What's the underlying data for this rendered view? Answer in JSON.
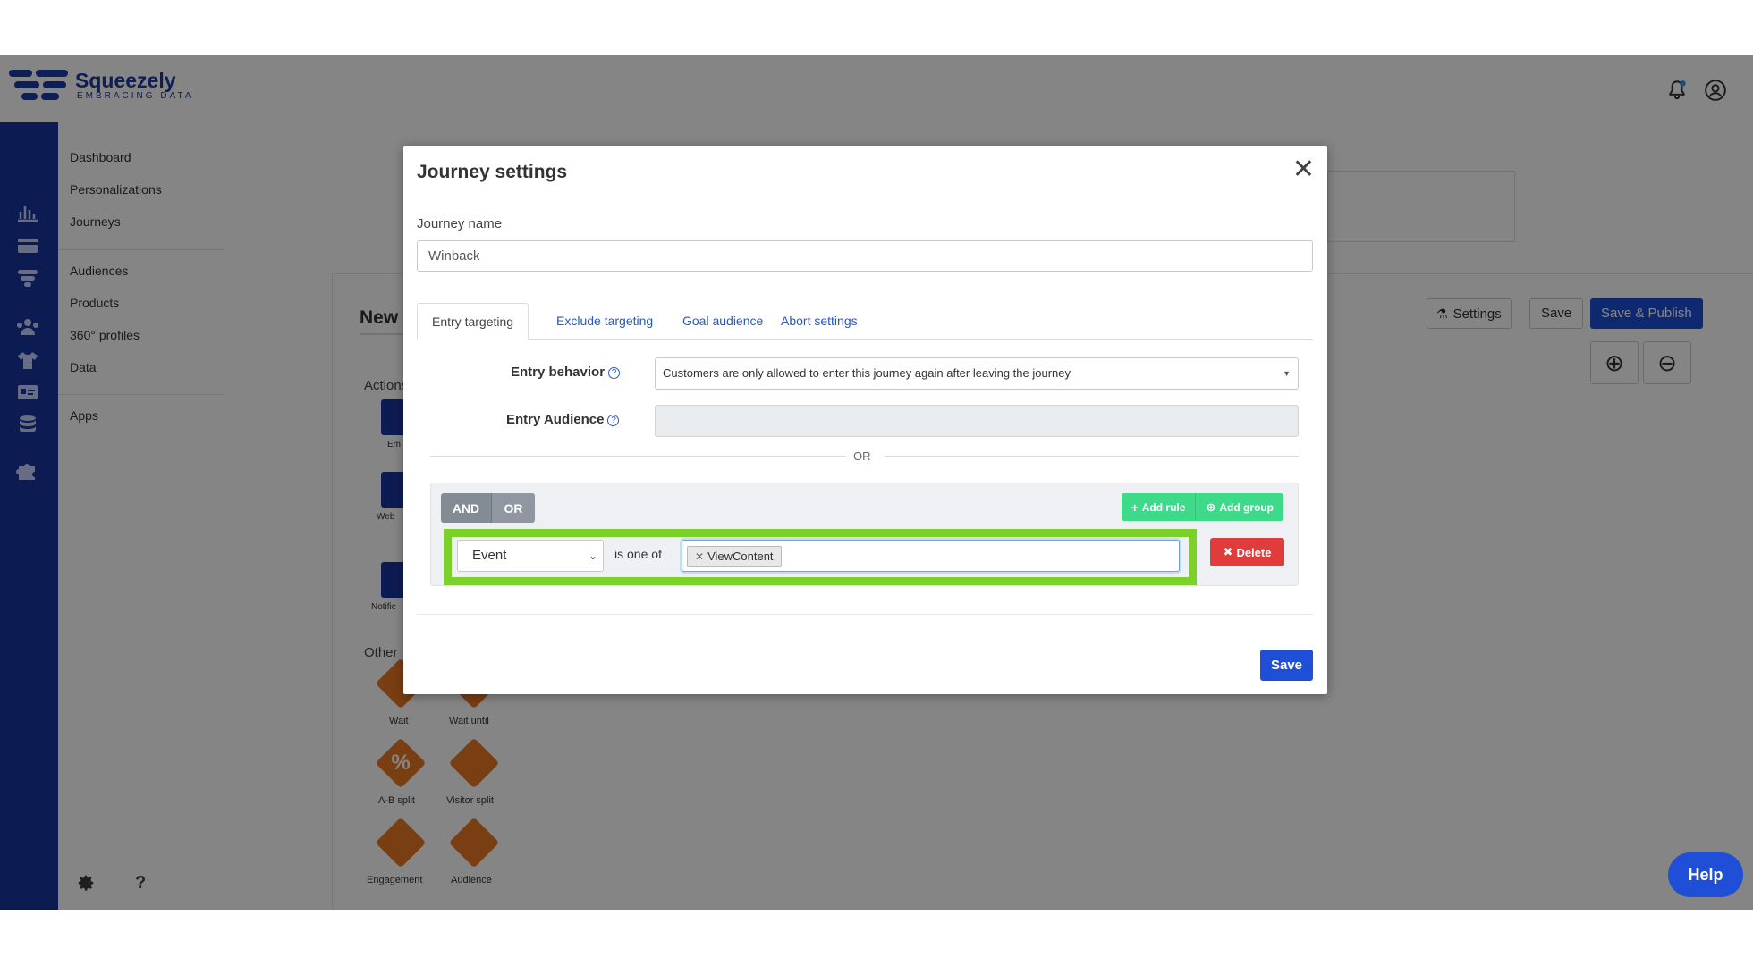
{
  "brand": {
    "name": "Squeezely",
    "tagline": "EMBRACING DATA",
    "accent": "#1a359f"
  },
  "topbar": {
    "icons": [
      "bell-icon",
      "user-circle-icon"
    ]
  },
  "rail": {
    "icons": [
      "bar-chart-icon",
      "card-icon",
      "journey-icon",
      "users-icon",
      "shirt-icon",
      "id-card-icon",
      "database-icon",
      "puzzle-icon"
    ]
  },
  "sidenav": {
    "items": [
      "Dashboard",
      "Personalizations",
      "Journeys",
      "Audiences",
      "Products",
      "360° profiles",
      "Data",
      "Apps"
    ],
    "bottom_icons": [
      "gear-icon",
      "question-icon"
    ]
  },
  "main": {
    "page_title": "New",
    "settings_label": "Settings",
    "save_label": "Save",
    "publish_label": "Save & Publish",
    "actions_label": "Actions",
    "other_label": "Other",
    "action_items": [
      "Em",
      "Web",
      "Notific"
    ],
    "other_items": [
      "Wait",
      "Wait until",
      "A-B split",
      "Visitor split",
      "Engagement",
      "Audience"
    ]
  },
  "help_label": "Help",
  "modal": {
    "title": "Journey settings",
    "name_label": "Journey name",
    "name_value": "Winback",
    "tabs": [
      "Entry targeting",
      "Exclude targeting",
      "Goal audience",
      "Abort settings"
    ],
    "entry_behavior_label": "Entry behavior",
    "entry_behavior_value": "Customers are only allowed to enter this journey again after leaving the journey",
    "entry_audience_label": "Entry Audience",
    "or_label": "OR",
    "query": {
      "and_label": "AND",
      "or_label": "OR",
      "add_rule_label": "Add rule",
      "add_group_label": "Add group",
      "field": "Event",
      "operator": "is one of",
      "values": [
        "ViewContent"
      ],
      "delete_label": "Delete"
    },
    "save_label": "Save"
  }
}
